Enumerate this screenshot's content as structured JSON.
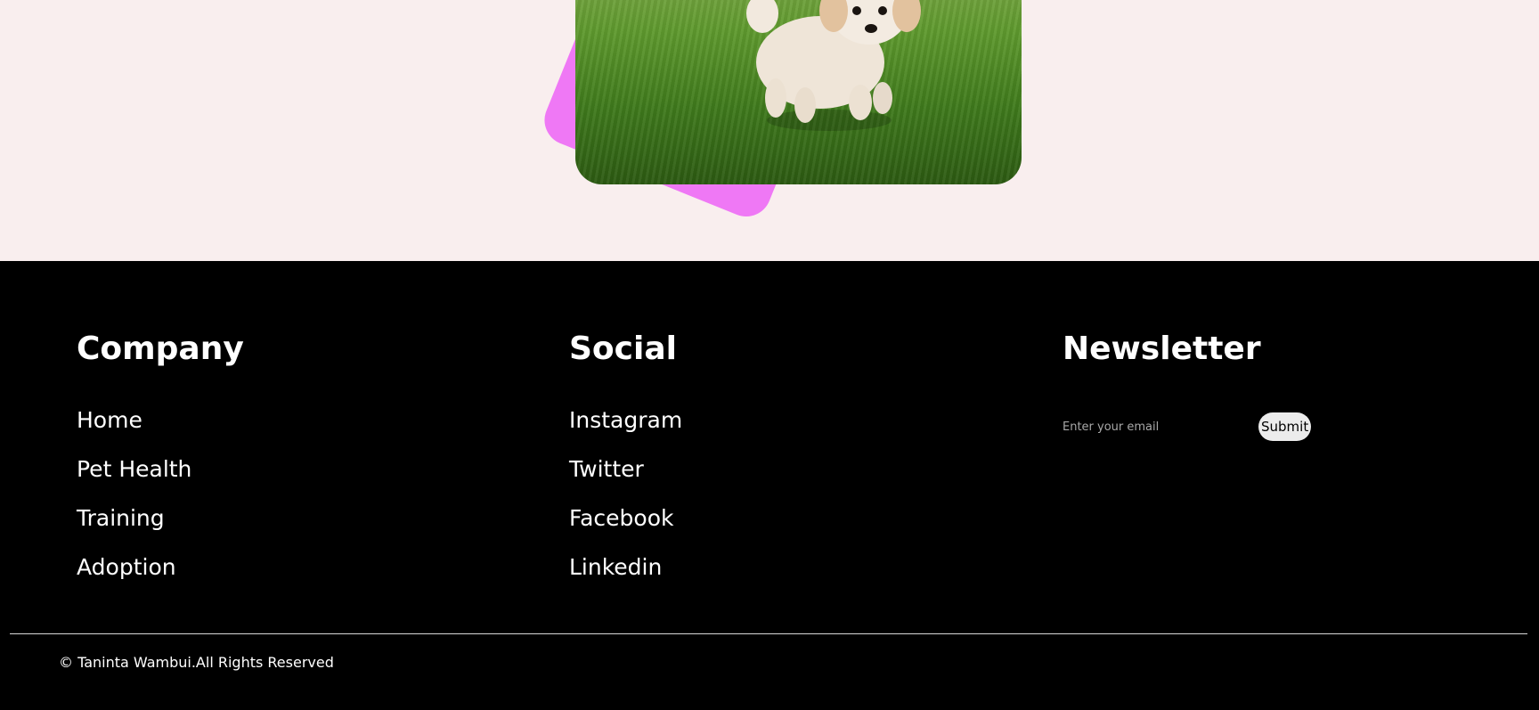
{
  "footer": {
    "company": {
      "heading": "Company",
      "links": [
        "Home",
        "Pet Health",
        "Training",
        "Adoption"
      ]
    },
    "social": {
      "heading": "Social",
      "links": [
        "Instagram",
        "Twitter",
        "Facebook",
        "Linkedin"
      ]
    },
    "newsletter": {
      "heading": "Newsletter",
      "email_placeholder": "Enter your email",
      "submit_label": "Submit"
    },
    "copyright": "© Taninta Wambui.All Rights Reserved"
  },
  "colors": {
    "hero_background": "#f9eeee",
    "accent_pink": "#ef78f5",
    "footer_background": "#000000"
  }
}
